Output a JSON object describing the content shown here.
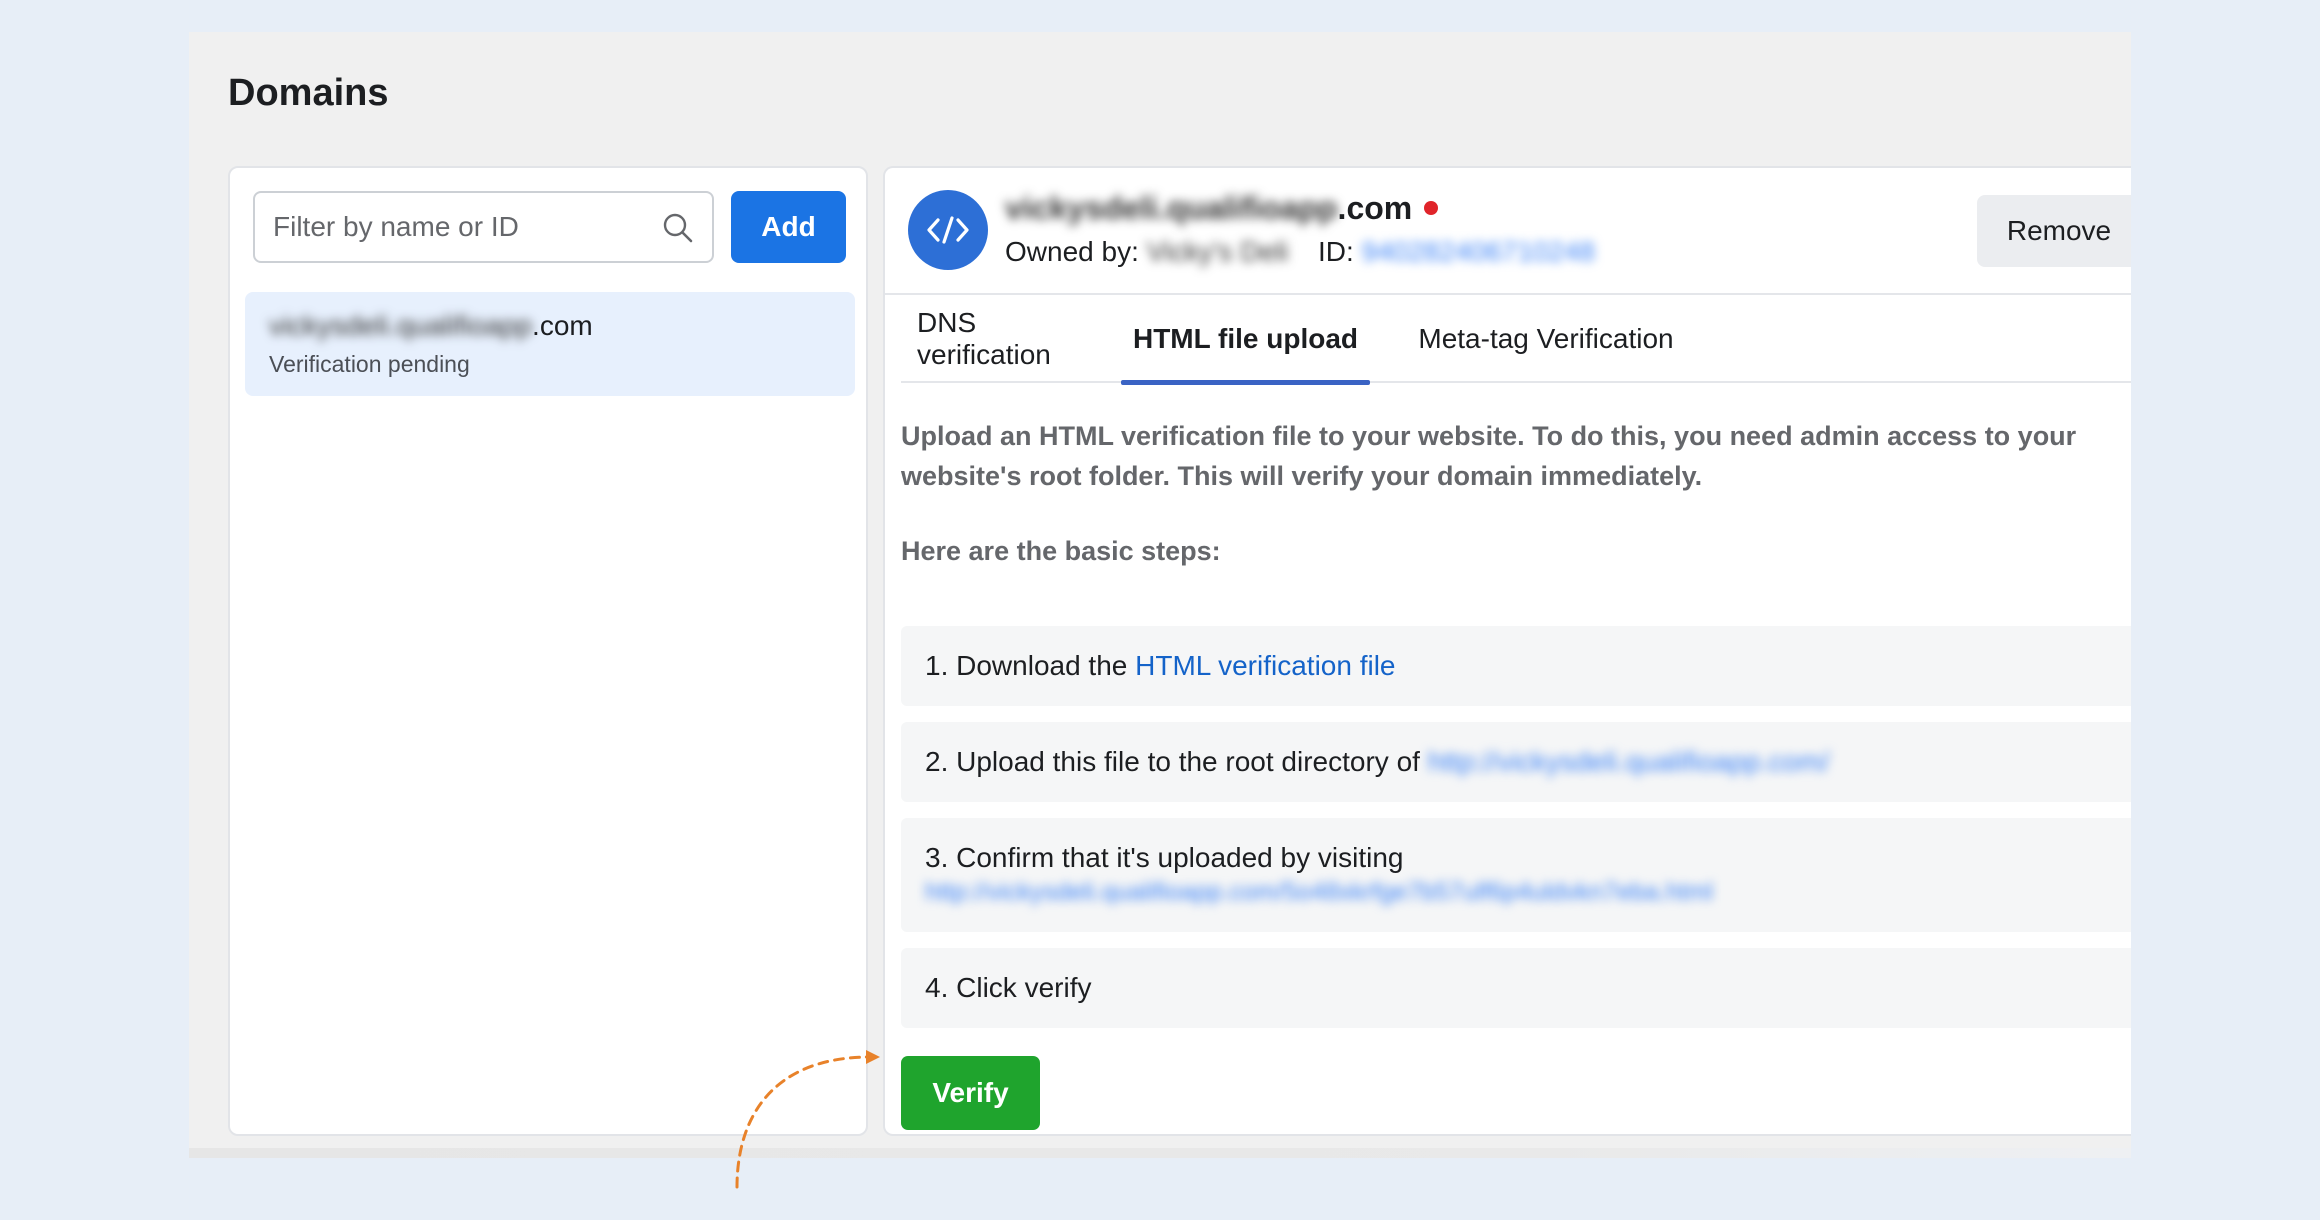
{
  "page": {
    "title": "Domains"
  },
  "sidebar": {
    "search_placeholder": "Filter by name or ID",
    "add_label": "Add",
    "items": [
      {
        "name_blurred": "vickysdeli.qualifioapp",
        "name_suffix": ".com",
        "status": "Verification pending"
      }
    ]
  },
  "domain": {
    "name_blurred": "vickysdeli.qualifioapp",
    "name_suffix": ".com",
    "owned_by_label": "Owned by:",
    "owner_blurred": "Vicky's Deli",
    "id_label": "ID:",
    "id_blurred": "940282406710248",
    "remove_label": "Remove",
    "status_color": "#e0242a"
  },
  "tabs": [
    {
      "label": "DNS verification",
      "active": false
    },
    {
      "label": "HTML file upload",
      "active": true
    },
    {
      "label": "Meta-tag Verification",
      "active": false
    }
  ],
  "content": {
    "intro_line1": "Upload an HTML verification file to your website. To do this, you need admin access to your",
    "intro_line2": "website's root folder. This will verify your domain immediately.",
    "steps_heading": "Here are the basic steps:",
    "step1_text": "1. Download the ",
    "step1_link": "HTML verification file",
    "step2_text": "2. Upload this file to the root directory of ",
    "step2_link_blurred": "http://vickysdeli.qualifioapp.com/",
    "step3_text": "3. Confirm that it's uploaded by visiting",
    "step3_link_blurred": "http://vickysdeli.qualifioapp.com/5o48xkrfge7b57ulf6p4uldvkn7eba.html",
    "step4_text": "4. Click verify",
    "verify_label": "Verify"
  },
  "colors": {
    "primary": "#1b74e4",
    "verify": "#1fa42d",
    "annotation_arrow": "#e8822a"
  }
}
